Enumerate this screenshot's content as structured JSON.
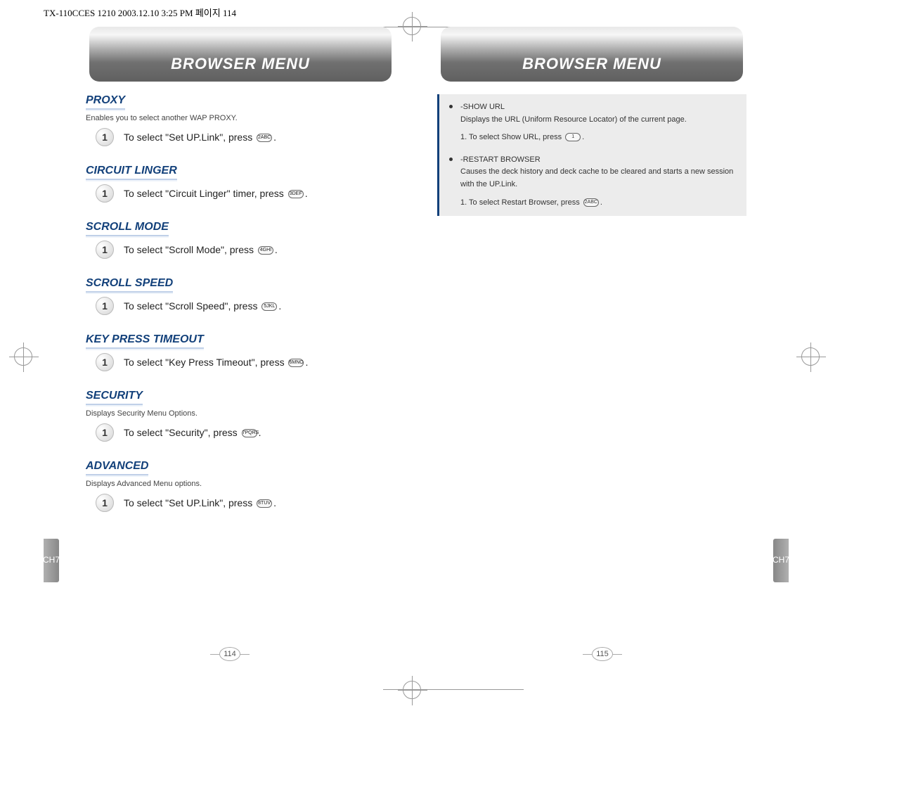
{
  "printHeader": "TX-110CCES 1210  2003.12.10 3:25 PM  페이지 114",
  "titleLeft": "BROWSER MENU",
  "titleRight": "BROWSER MENU",
  "sideTabLeft": "CH7",
  "sideTabRight": "CH7",
  "pageNumLeft": "114",
  "pageNumRight": "115",
  "sections": {
    "proxy": {
      "title": "PROXY",
      "desc": "Enables you to select another WAP PROXY.",
      "stepNum": "1",
      "stepTextA": "To select \"Set UP.Link\", press ",
      "stepKey": "2ABC",
      "stepTextB": "."
    },
    "circuit": {
      "title": "CIRCUIT LINGER",
      "stepNum": "1",
      "stepTextA": "To select \"Circuit Linger\" timer, press ",
      "stepKey": "3DEF",
      "stepTextB": "."
    },
    "scrollMode": {
      "title": "SCROLL MODE",
      "stepNum": "1",
      "stepTextA": "To select \"Scroll Mode\", press ",
      "stepKey": "4GHI",
      "stepTextB": "."
    },
    "scrollSpeed": {
      "title": "SCROLL SPEED",
      "stepNum": "1",
      "stepTextA": "To select \"Scroll Speed\", press ",
      "stepKey": "5JKL",
      "stepTextB": "."
    },
    "keyPress": {
      "title": "KEY PRESS TIMEOUT",
      "stepNum": "1",
      "stepTextA": "To select \"Key Press Timeout\", press ",
      "stepKey": "6MNO",
      "stepTextB": "."
    },
    "security": {
      "title": "SECURITY",
      "desc": "Displays Security Menu Options.",
      "stepNum": "1",
      "stepTextA": "To select \"Security\", press ",
      "stepKey": "7PQRS",
      "stepTextB": "."
    },
    "advanced": {
      "title": "ADVANCED",
      "desc": "Displays Advanced Menu options.",
      "stepNum": "1",
      "stepTextA": "To select \"Set UP.Link\", press ",
      "stepKey": "8TUV",
      "stepTextB": "."
    }
  },
  "info": {
    "showUrl": {
      "title": "-SHOW URL",
      "desc": "Displays the URL (Uniform Resource Locator) of the current page.",
      "stepA": "1. To select Show URL, press ",
      "stepKey": "1",
      "stepB": "."
    },
    "restart": {
      "title": "-RESTART BROWSER",
      "desc": "Causes the deck history and deck cache to be cleared and starts a new session with the UP.Link.",
      "stepA": "1. To select Restart Browser, press ",
      "stepKey": "2ABC",
      "stepB": "."
    }
  }
}
